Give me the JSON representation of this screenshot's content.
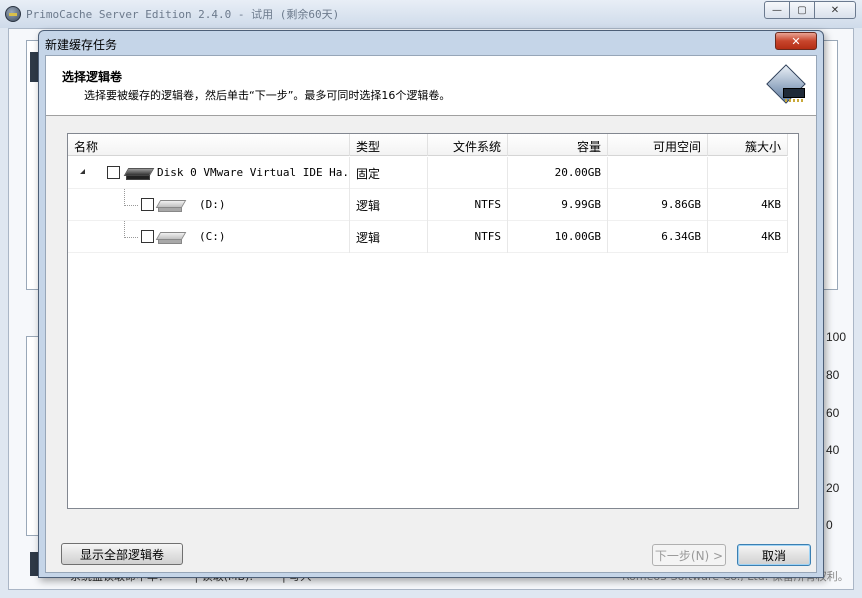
{
  "main_window": {
    "title": "PrimoCache Server Edition 2.4.0 - 试用 (剩余60天)",
    "controls": {
      "minimize": "—",
      "restore": "▢",
      "close": "✕"
    },
    "chart_axis_ticks": [
      "100",
      "80",
      "60",
      "40",
      "20",
      "0"
    ],
    "status_left": "系统盘读取命中率：—— | 读取(MB): —— | 写入",
    "status_right": "Romeo3 Software Co., Ltd. 保留所有权利。"
  },
  "dialog": {
    "title": "新建缓存任务",
    "close_label": "✕",
    "header": {
      "title": "选择逻辑卷",
      "subtitle": "选择要被缓存的逻辑卷，然后单击“下一步”。最多可同时选择16个逻辑卷。"
    },
    "table": {
      "columns": [
        "名称",
        "类型",
        "文件系统",
        "容量",
        "可用空间",
        "簇大小"
      ],
      "rows": [
        {
          "name": "Disk 0 VMware Virtual IDE Ha...",
          "type": "固定",
          "fs": "",
          "capacity": "20.00GB",
          "free": "",
          "cluster": ""
        },
        {
          "name": "(D:)",
          "type": "逻辑",
          "fs": "NTFS",
          "capacity": "9.99GB",
          "free": "9.86GB",
          "cluster": "4KB"
        },
        {
          "name": "(C:)",
          "type": "逻辑",
          "fs": "NTFS",
          "capacity": "10.00GB",
          "free": "6.34GB",
          "cluster": "4KB"
        }
      ]
    },
    "buttons": {
      "show_all": "显示全部逻辑卷",
      "next": "下一步(N) >",
      "cancel": "取消"
    }
  }
}
